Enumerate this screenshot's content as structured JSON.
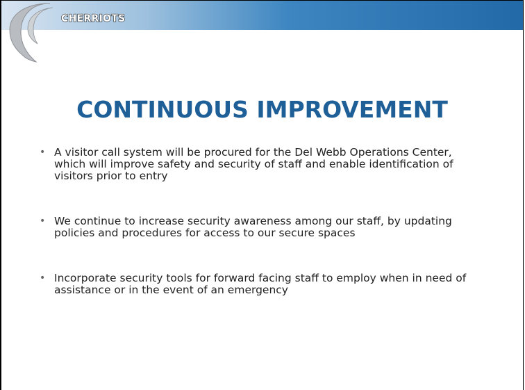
{
  "header": {
    "logo_text": "Cherriots"
  },
  "slide": {
    "title": "CONTINUOUS IMPROVEMENT",
    "bullets": [
      "A visitor call system will be procured for the Del Webb Operations Center, which will improve safety and security of staff and enable identification of visitors prior to entry",
      "We continue to increase security awareness among our staff, by updating policies and procedures for access to our secure spaces",
      "Incorporate security tools for forward facing staff to employ when in need of assistance or in the event of an emergency"
    ]
  },
  "colors": {
    "title": "#1f5f97",
    "header_blue": "#2269a8",
    "logo_arc_gray": "#b9bcc0"
  }
}
